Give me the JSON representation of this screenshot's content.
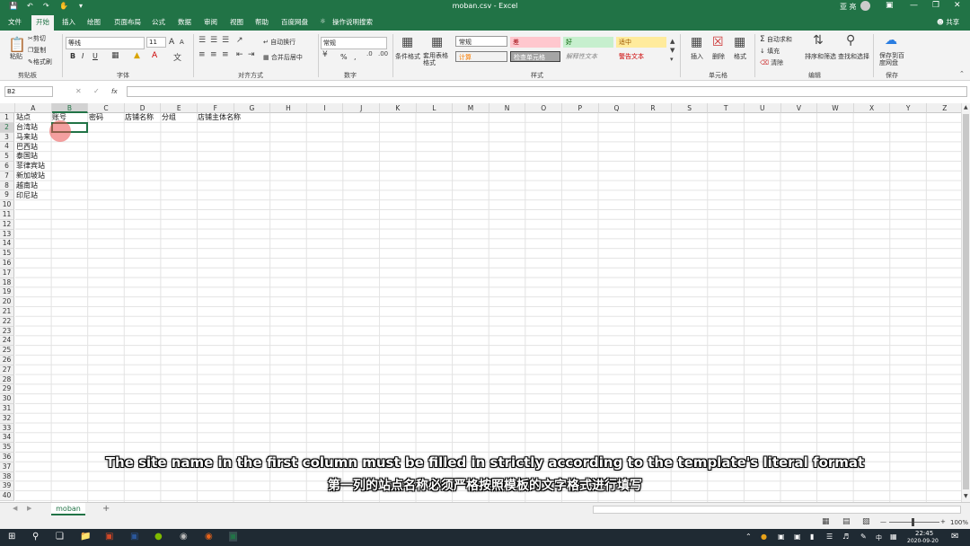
{
  "title": "moban.csv - Excel",
  "user": "亚 亮",
  "share": "共享",
  "tabs": [
    "文件",
    "开始",
    "插入",
    "绘图",
    "页面布局",
    "公式",
    "数据",
    "审阅",
    "视图",
    "帮助",
    "百度网盘",
    "操作说明搜索"
  ],
  "clipboard": {
    "paste": "粘贴",
    "cut": "剪切",
    "copy": "复制",
    "painter": "格式刷",
    "group": "剪贴板"
  },
  "font": {
    "name": "等线",
    "size": "11",
    "group": "字体",
    "bold": "B",
    "italic": "I",
    "underline": "U",
    "grow": "A",
    "shrink": "A"
  },
  "align": {
    "wrap": "自动换行",
    "merge": "合并后居中",
    "group": "对齐方式"
  },
  "number": {
    "format": "常规",
    "percent": "%",
    "comma": ",",
    "group": "数字"
  },
  "styles": {
    "cond": "条件格式",
    "table": "套用表格格式",
    "normal": "常规",
    "bad": "差",
    "good": "好",
    "neutral": "适中",
    "calc": "计算",
    "check": "检查单元格",
    "explain": "解释性文本",
    "warn": "警告文本",
    "group": "样式"
  },
  "cells": {
    "insert": "插入",
    "delete": "删除",
    "format": "格式",
    "group": "单元格"
  },
  "editing": {
    "autosum": "自动求和",
    "fill": "填充",
    "clear": "清除",
    "sort": "排序和筛选",
    "find": "查找和选择",
    "group": "编辑"
  },
  "save": {
    "baidu": "保存到百度网盘",
    "group": "保存"
  },
  "namebox": "B2",
  "fx": "fx",
  "columns": [
    "A",
    "B",
    "C",
    "D",
    "E",
    "F",
    "G",
    "H",
    "I",
    "J",
    "K",
    "L",
    "M",
    "N",
    "O",
    "P",
    "Q",
    "R",
    "S",
    "T",
    "U",
    "V",
    "W",
    "X",
    "Y",
    "Z"
  ],
  "rows": [
    "1",
    "2",
    "3",
    "4",
    "5",
    "6",
    "7",
    "8",
    "9",
    "10",
    "11",
    "12",
    "13",
    "14",
    "15",
    "16",
    "17",
    "18",
    "19",
    "20",
    "21",
    "22",
    "23",
    "24",
    "25",
    "26",
    "27",
    "28",
    "29",
    "30",
    "31",
    "32",
    "33",
    "34",
    "35",
    "36",
    "37",
    "38",
    "39",
    "40"
  ],
  "header_row": [
    "站点",
    "账号",
    "密码",
    "店铺名称",
    "分组",
    "店铺主体名称"
  ],
  "sites": [
    "台湾站",
    "马来站",
    "巴西站",
    "泰国站",
    "菲律宾站",
    "新加坡站",
    "越南站",
    "印尼站"
  ],
  "sheet": "moban",
  "add_sheet": "+",
  "zoom": "100%",
  "time": "22:45",
  "date": "2020-09-20",
  "ime": "中",
  "subtitle_en": "The site name in the first column must be filled in strictly according to the template's literal format",
  "subtitle_zh": "第一列的站点名称必须严格按照模板的文字格式进行填写"
}
